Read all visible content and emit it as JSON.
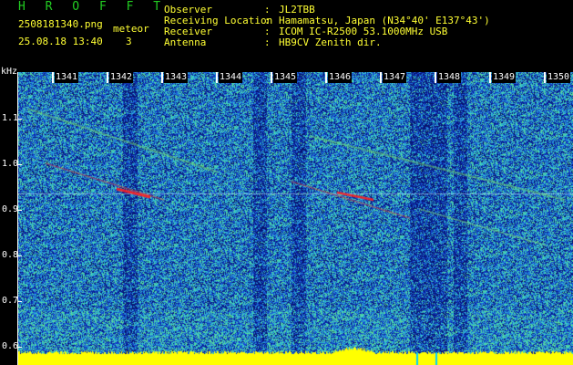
{
  "header": {
    "brand": "H R O F F T",
    "filename": "2508181340.png",
    "datetime": "25.08.18 13:40",
    "mode_label": "meteor",
    "count": "3",
    "fields": [
      {
        "label": "Observer",
        "value": "JL2TBB"
      },
      {
        "label": "Receiving Location",
        "value": "Hamamatsu, Japan (N34°40' E137°43')"
      },
      {
        "label": "Receiver",
        "value": "ICOM IC-R2500 53.1000MHz USB"
      },
      {
        "label": "Antenna",
        "value": "HB9CV Zenith dir."
      }
    ]
  },
  "y_axis": {
    "unit": "kHz",
    "ticks": [
      "1.1",
      "1.0",
      "0.9",
      "0.8",
      "0.7",
      "0.6"
    ],
    "range": [
      0.58,
      1.2
    ]
  },
  "x_axis": {
    "ticks": [
      "1341",
      "1342",
      "1343",
      "1344",
      "1345",
      "1346",
      "1347",
      "1348",
      "1349",
      "1350"
    ]
  },
  "colors": {
    "background": "#000000",
    "brand": "#22cc22",
    "info_text": "#ffff33",
    "baseline": "#ffff00",
    "noise_dark": "#081a7a",
    "noise_mid": "#1f5fd8",
    "noise_light": "#2fd0d8",
    "signal": "#ff3030"
  }
}
